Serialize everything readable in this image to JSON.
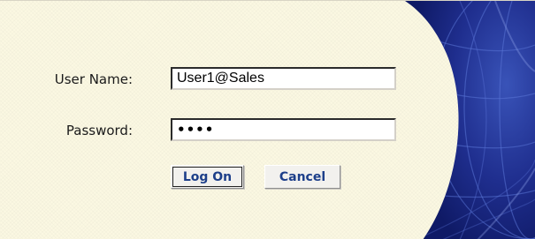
{
  "login": {
    "username_label": "User Name:",
    "username_value": "User1@Sales",
    "password_label": "Password:",
    "password_value": "abcd",
    "logon_button": "Log On",
    "cancel_button": "Cancel"
  },
  "theme": {
    "panel_background": "#fbf8e2",
    "brand_blue": "#1f2e8e",
    "button_text": "#1d3f8a"
  },
  "decoration": {
    "brand_art_icon": "globe-swirl-icon"
  }
}
